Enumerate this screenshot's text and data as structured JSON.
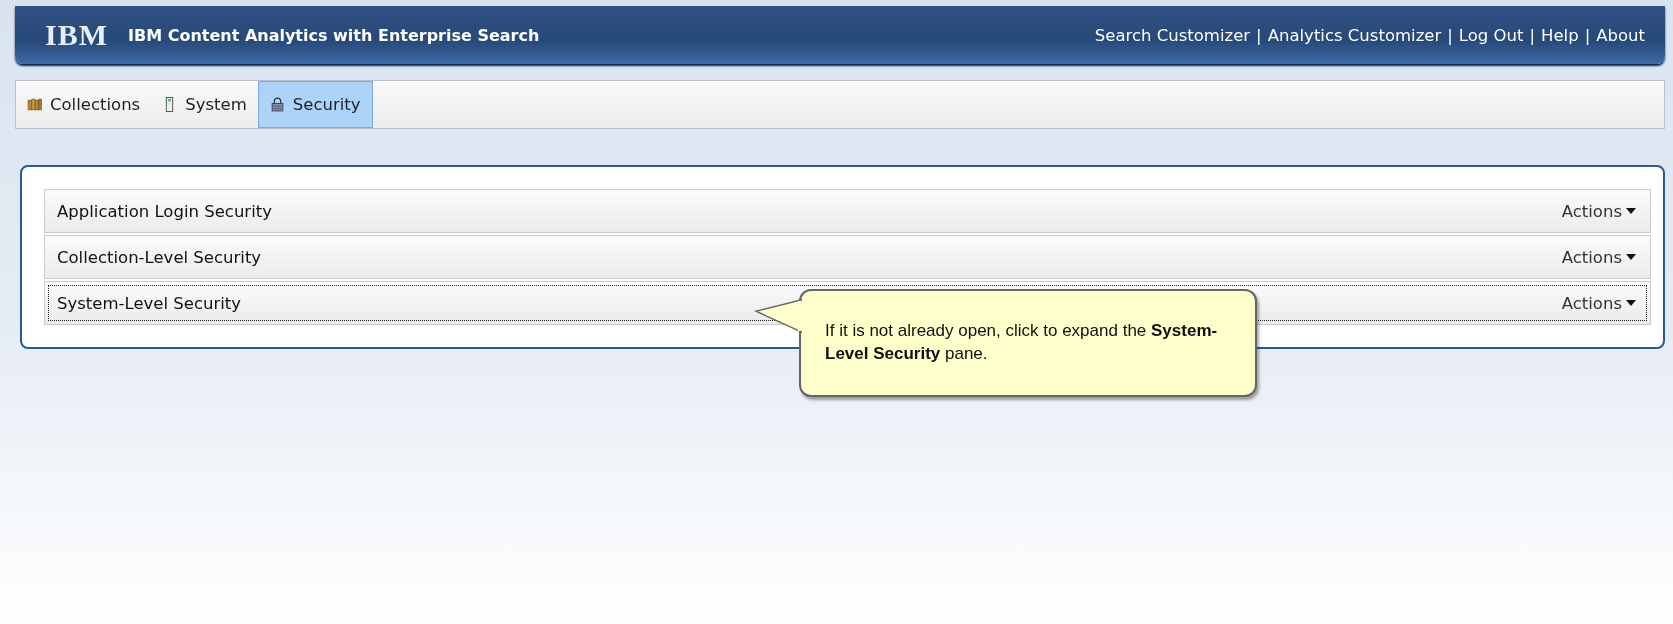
{
  "header": {
    "logo": "IBM",
    "title": "IBM Content Analytics with Enterprise Search",
    "separator": "|",
    "links": [
      "Search Customizer",
      "Analytics Customizer",
      "Log Out",
      "Help",
      "About"
    ]
  },
  "tabs": [
    {
      "label": "Collections",
      "selected": false
    },
    {
      "label": "System",
      "selected": false
    },
    {
      "label": "Security",
      "selected": true
    }
  ],
  "panes": [
    {
      "title": "Application Login Security",
      "actions": "Actions",
      "focused": false
    },
    {
      "title": "Collection-Level Security",
      "actions": "Actions",
      "focused": false
    },
    {
      "title": "System-Level Security",
      "actions": "Actions",
      "focused": true
    }
  ],
  "callout": {
    "text": "If it is not already open, click to expand the **System-Level Security** pane."
  }
}
